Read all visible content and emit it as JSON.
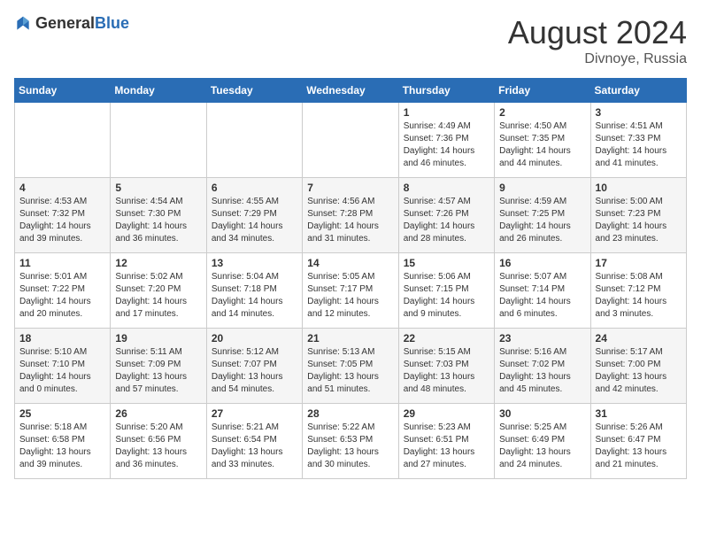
{
  "header": {
    "logo_general": "General",
    "logo_blue": "Blue",
    "month_year": "August 2024",
    "location": "Divnoye, Russia"
  },
  "weekdays": [
    "Sunday",
    "Monday",
    "Tuesday",
    "Wednesday",
    "Thursday",
    "Friday",
    "Saturday"
  ],
  "weeks": [
    [
      {
        "day": "",
        "info": ""
      },
      {
        "day": "",
        "info": ""
      },
      {
        "day": "",
        "info": ""
      },
      {
        "day": "",
        "info": ""
      },
      {
        "day": "1",
        "info": "Sunrise: 4:49 AM\nSunset: 7:36 PM\nDaylight: 14 hours\nand 46 minutes."
      },
      {
        "day": "2",
        "info": "Sunrise: 4:50 AM\nSunset: 7:35 PM\nDaylight: 14 hours\nand 44 minutes."
      },
      {
        "day": "3",
        "info": "Sunrise: 4:51 AM\nSunset: 7:33 PM\nDaylight: 14 hours\nand 41 minutes."
      }
    ],
    [
      {
        "day": "4",
        "info": "Sunrise: 4:53 AM\nSunset: 7:32 PM\nDaylight: 14 hours\nand 39 minutes."
      },
      {
        "day": "5",
        "info": "Sunrise: 4:54 AM\nSunset: 7:30 PM\nDaylight: 14 hours\nand 36 minutes."
      },
      {
        "day": "6",
        "info": "Sunrise: 4:55 AM\nSunset: 7:29 PM\nDaylight: 14 hours\nand 34 minutes."
      },
      {
        "day": "7",
        "info": "Sunrise: 4:56 AM\nSunset: 7:28 PM\nDaylight: 14 hours\nand 31 minutes."
      },
      {
        "day": "8",
        "info": "Sunrise: 4:57 AM\nSunset: 7:26 PM\nDaylight: 14 hours\nand 28 minutes."
      },
      {
        "day": "9",
        "info": "Sunrise: 4:59 AM\nSunset: 7:25 PM\nDaylight: 14 hours\nand 26 minutes."
      },
      {
        "day": "10",
        "info": "Sunrise: 5:00 AM\nSunset: 7:23 PM\nDaylight: 14 hours\nand 23 minutes."
      }
    ],
    [
      {
        "day": "11",
        "info": "Sunrise: 5:01 AM\nSunset: 7:22 PM\nDaylight: 14 hours\nand 20 minutes."
      },
      {
        "day": "12",
        "info": "Sunrise: 5:02 AM\nSunset: 7:20 PM\nDaylight: 14 hours\nand 17 minutes."
      },
      {
        "day": "13",
        "info": "Sunrise: 5:04 AM\nSunset: 7:18 PM\nDaylight: 14 hours\nand 14 minutes."
      },
      {
        "day": "14",
        "info": "Sunrise: 5:05 AM\nSunset: 7:17 PM\nDaylight: 14 hours\nand 12 minutes."
      },
      {
        "day": "15",
        "info": "Sunrise: 5:06 AM\nSunset: 7:15 PM\nDaylight: 14 hours\nand 9 minutes."
      },
      {
        "day": "16",
        "info": "Sunrise: 5:07 AM\nSunset: 7:14 PM\nDaylight: 14 hours\nand 6 minutes."
      },
      {
        "day": "17",
        "info": "Sunrise: 5:08 AM\nSunset: 7:12 PM\nDaylight: 14 hours\nand 3 minutes."
      }
    ],
    [
      {
        "day": "18",
        "info": "Sunrise: 5:10 AM\nSunset: 7:10 PM\nDaylight: 14 hours\nand 0 minutes."
      },
      {
        "day": "19",
        "info": "Sunrise: 5:11 AM\nSunset: 7:09 PM\nDaylight: 13 hours\nand 57 minutes."
      },
      {
        "day": "20",
        "info": "Sunrise: 5:12 AM\nSunset: 7:07 PM\nDaylight: 13 hours\nand 54 minutes."
      },
      {
        "day": "21",
        "info": "Sunrise: 5:13 AM\nSunset: 7:05 PM\nDaylight: 13 hours\nand 51 minutes."
      },
      {
        "day": "22",
        "info": "Sunrise: 5:15 AM\nSunset: 7:03 PM\nDaylight: 13 hours\nand 48 minutes."
      },
      {
        "day": "23",
        "info": "Sunrise: 5:16 AM\nSunset: 7:02 PM\nDaylight: 13 hours\nand 45 minutes."
      },
      {
        "day": "24",
        "info": "Sunrise: 5:17 AM\nSunset: 7:00 PM\nDaylight: 13 hours\nand 42 minutes."
      }
    ],
    [
      {
        "day": "25",
        "info": "Sunrise: 5:18 AM\nSunset: 6:58 PM\nDaylight: 13 hours\nand 39 minutes."
      },
      {
        "day": "26",
        "info": "Sunrise: 5:20 AM\nSunset: 6:56 PM\nDaylight: 13 hours\nand 36 minutes."
      },
      {
        "day": "27",
        "info": "Sunrise: 5:21 AM\nSunset: 6:54 PM\nDaylight: 13 hours\nand 33 minutes."
      },
      {
        "day": "28",
        "info": "Sunrise: 5:22 AM\nSunset: 6:53 PM\nDaylight: 13 hours\nand 30 minutes."
      },
      {
        "day": "29",
        "info": "Sunrise: 5:23 AM\nSunset: 6:51 PM\nDaylight: 13 hours\nand 27 minutes."
      },
      {
        "day": "30",
        "info": "Sunrise: 5:25 AM\nSunset: 6:49 PM\nDaylight: 13 hours\nand 24 minutes."
      },
      {
        "day": "31",
        "info": "Sunrise: 5:26 AM\nSunset: 6:47 PM\nDaylight: 13 hours\nand 21 minutes."
      }
    ]
  ]
}
